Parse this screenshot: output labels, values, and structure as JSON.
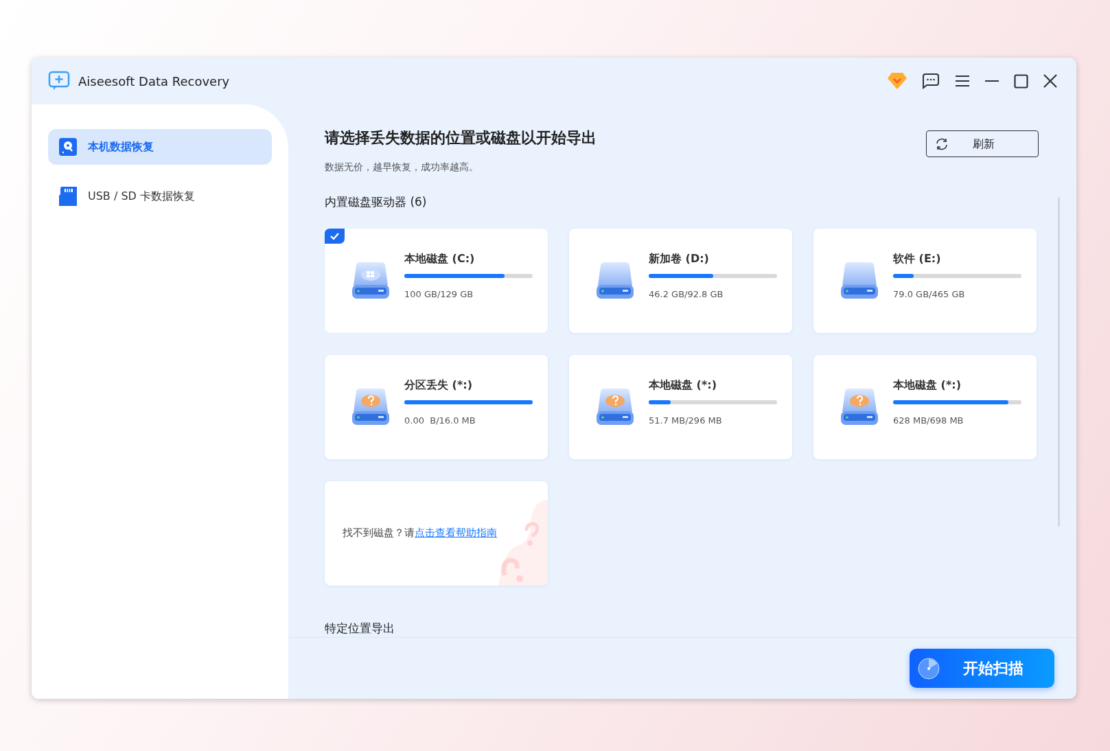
{
  "window": {
    "title": "Aiseesoft Data Recovery"
  },
  "sidebar": {
    "items": [
      {
        "label": "本机数据恢复",
        "kind": "disk",
        "selected": true
      },
      {
        "label": "USB / SD 卡数据恢复",
        "kind": "sd",
        "selected": false
      }
    ]
  },
  "main": {
    "heading": "请选择丢失数据的位置或磁盘以开始导出",
    "subtitle": "数据无价，越早恢复，成功率越高。",
    "refresh_button": "刷新",
    "section_label": "内置磁盘驱动器 (6)",
    "drives": [
      {
        "name": "本地磁盘 (C:)",
        "kind": "system",
        "usage": "100 GB/129 GB",
        "level": 0.78,
        "selected": true
      },
      {
        "name": "新加卷 (D:)",
        "kind": "plain",
        "usage": "46.2 GB/92.8 GB",
        "level": 0.5,
        "selected": false
      },
      {
        "name": "软件 (E:)",
        "kind": "plain",
        "usage": "79.0 GB/465 GB",
        "level": 0.16,
        "selected": false
      },
      {
        "name": "分区丢失 (*:)",
        "kind": "unknown",
        "usage": "0.00  B/16.0 MB",
        "level": 1,
        "selected": false
      },
      {
        "name": "本地磁盘 (*:)",
        "kind": "unknown",
        "usage": "51.7 MB/296 MB",
        "level": 0.17,
        "selected": false
      },
      {
        "name": "本地磁盘 (*:)",
        "kind": "unknown",
        "usage": "628 MB/698 MB",
        "level": 0.9,
        "selected": false
      }
    ],
    "help_card": {
      "text": "找不到磁盘？请",
      "link": "点击查看帮助指南"
    },
    "section_label_2": "特定位置导出"
  },
  "scan_button": "开始扫描"
}
